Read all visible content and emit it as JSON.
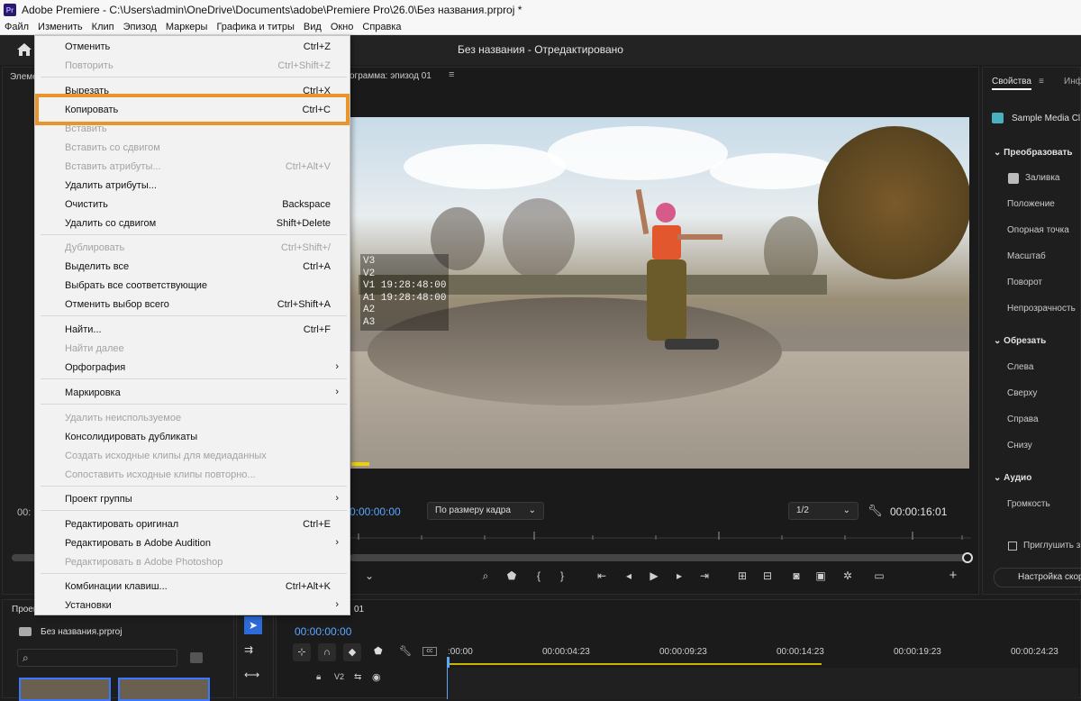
{
  "titlebar": {
    "app_icon": "Pr",
    "title": "Adobe Premiere - C:\\Users\\admin\\OneDrive\\Documents\\adobe\\Premiere Pro\\26.0\\Без названия.prproj *"
  },
  "menubar": {
    "items": [
      "Файл",
      "Изменить",
      "Клип",
      "Эпизод",
      "Маркеры",
      "Графика и титры",
      "Вид",
      "Окно",
      "Справка"
    ]
  },
  "header": {
    "title": "Без названия - Отредактировано"
  },
  "left_panel": {
    "tab_label": "Элеме",
    "timecode": "00:"
  },
  "program_monitor": {
    "tab_label": "ограмма: эпизод 01",
    "overlay_lines": [
      "V3",
      "V2",
      "V1 19:28:48:00",
      "A1 19:28:48:00",
      "A2",
      "A3"
    ],
    "timecode_left": "0:00:00:00",
    "fit_select": "По размеру кадра",
    "resolution_select": "1/2",
    "timecode_right": "00:00:16:01"
  },
  "properties_panel": {
    "tab": "Свойства",
    "tab2": "Инф",
    "clip_name": "Sample Media Cl",
    "sections": [
      {
        "title": "Преобразовать",
        "items": [
          "Заливка",
          "Положение",
          "Опорная точка",
          "Масштаб",
          "Поворот",
          "Непрозрачность"
        ]
      },
      {
        "title": "Обрезать",
        "items": [
          "Слева",
          "Сверху",
          "Справа",
          "Снизу"
        ]
      },
      {
        "title": "Аудио",
        "items": [
          "Громкость"
        ]
      }
    ],
    "mute_label": "Приглушить з",
    "settings_button": "Настройка скор"
  },
  "edit_menu": {
    "items": [
      {
        "label": "Отменить",
        "shortcut": "Ctrl+Z",
        "disabled": false
      },
      {
        "label": "Повторить",
        "shortcut": "Ctrl+Shift+Z",
        "disabled": true
      },
      {
        "label": "Вырезать",
        "shortcut": "Ctrl+X",
        "disabled": false
      },
      {
        "label": "Копировать",
        "shortcut": "Ctrl+C",
        "disabled": false
      },
      {
        "label": "Вставить",
        "shortcut": "",
        "disabled": true
      },
      {
        "label": "Вставить со сдвигом",
        "shortcut": "",
        "disabled": true
      },
      {
        "label": "Вставить атрибуты...",
        "shortcut": "Ctrl+Alt+V",
        "disabled": true
      },
      {
        "label": "Удалить атрибуты...",
        "shortcut": "",
        "disabled": false
      },
      {
        "label": "Очистить",
        "shortcut": "Backspace",
        "disabled": false
      },
      {
        "label": "Удалить со сдвигом",
        "shortcut": "Shift+Delete",
        "disabled": false
      },
      {
        "label": "Дублировать",
        "shortcut": "Ctrl+Shift+/",
        "disabled": true
      },
      {
        "label": "Выделить все",
        "shortcut": "Ctrl+A",
        "disabled": false
      },
      {
        "label": "Выбрать все соответствующие",
        "shortcut": "",
        "disabled": false
      },
      {
        "label": "Отменить выбор всего",
        "shortcut": "Ctrl+Shift+A",
        "disabled": false
      },
      {
        "label": "Найти...",
        "shortcut": "Ctrl+F",
        "disabled": false
      },
      {
        "label": "Найти далее",
        "shortcut": "",
        "disabled": true
      },
      {
        "label": "Орфография",
        "shortcut": "",
        "disabled": false,
        "submenu": true
      },
      {
        "label": "Маркировка",
        "shortcut": "",
        "disabled": false,
        "submenu": true
      },
      {
        "label": "Удалить неиспользуемое",
        "shortcut": "",
        "disabled": true
      },
      {
        "label": "Консолидировать дубликаты",
        "shortcut": "",
        "disabled": false
      },
      {
        "label": "Создать исходные клипы для медиаданных",
        "shortcut": "",
        "disabled": true
      },
      {
        "label": "Сопоставить исходные клипы повторно...",
        "shortcut": "",
        "disabled": true
      },
      {
        "label": "Проект группы",
        "shortcut": "",
        "disabled": false,
        "submenu": true
      },
      {
        "label": "Редактировать оригинал",
        "shortcut": "Ctrl+E",
        "disabled": false
      },
      {
        "label": "Редактировать в Adobe Audition",
        "shortcut": "",
        "disabled": false,
        "submenu": true
      },
      {
        "label": "Редактировать в Adobe Photoshop",
        "shortcut": "",
        "disabled": true
      },
      {
        "label": "Комбинации клавиш...",
        "shortcut": "Ctrl+Alt+K",
        "disabled": false
      },
      {
        "label": "Установки",
        "shortcut": "",
        "disabled": false,
        "submenu": true
      }
    ]
  },
  "project_panel": {
    "tab": "Проен",
    "file": "Без названия.prproj"
  },
  "timeline": {
    "tab": "01",
    "timecode": "00:00:00:00",
    "ruler_labels": [
      ":00:00",
      "00:00:04:23",
      "00:00:09:23",
      "00:00:14:23",
      "00:00:19:23",
      "00:00:24:23"
    ],
    "track_label": "V2"
  },
  "colors": {
    "highlight": "#e8962b",
    "timecode_blue": "#5aa7ff",
    "menu_bg": "#f2f2f2"
  }
}
